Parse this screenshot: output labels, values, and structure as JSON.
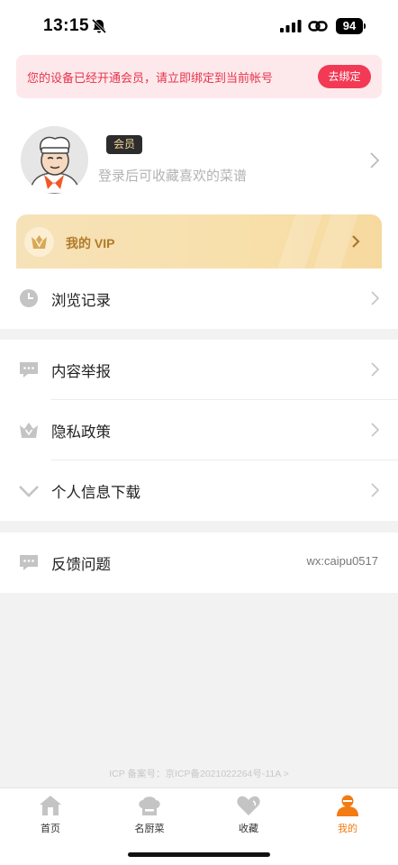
{
  "status_bar": {
    "time": "13:15",
    "battery": "94"
  },
  "banner": {
    "text": "您的设备已经开通会员，请立即绑定到当前帐号",
    "button": "去绑定"
  },
  "profile": {
    "badge": "会员",
    "hint": "登录后可收藏喜欢的菜谱"
  },
  "vip": {
    "label": "我的 VIP"
  },
  "menu": {
    "history": "浏览记录",
    "report": "内容举报",
    "privacy": "隐私政策",
    "download": "个人信息下载",
    "feedback": "反馈问题",
    "feedback_value": "wx:caipu0517"
  },
  "icp": "ICP 备案号：京ICP备2021022264号-11A >",
  "tabs": [
    {
      "label": "首页",
      "icon": "home-icon"
    },
    {
      "label": "名厨菜",
      "icon": "chef-hat-icon"
    },
    {
      "label": "收藏",
      "icon": "heart-icon"
    },
    {
      "label": "我的",
      "icon": "user-icon"
    }
  ],
  "colors": {
    "accent": "#f27b12",
    "banner_text": "#e8344c",
    "bind_button": "#f23a55",
    "vip_gold": "#b07a28"
  }
}
